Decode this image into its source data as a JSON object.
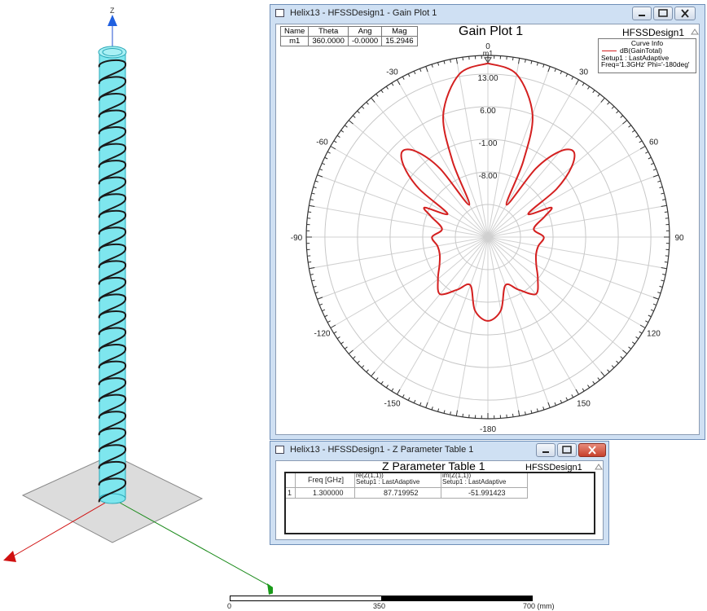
{
  "model_view": {
    "axis_z_label": "Z"
  },
  "scale_bar": {
    "labels": [
      "0",
      "350",
      "700 (mm)"
    ]
  },
  "gain_window": {
    "title": "Helix13 - HFSSDesign1 - Gain Plot 1",
    "plot_title": "Gain Plot 1",
    "design_name": "HFSSDesign1",
    "marker_table": {
      "headers": [
        "Name",
        "Theta",
        "Ang",
        "Mag"
      ],
      "row": [
        "m1",
        "360.0000",
        "-0.0000",
        "15.2946"
      ]
    },
    "curve_info": {
      "title": "Curve Info",
      "trace": "dB(GainTotal)",
      "setup": "Setup1 : LastAdaptive",
      "freq": "Freq='1.3GHz' Phi='-180deg'"
    },
    "marker_label": "m1",
    "accent_color": "#d42020"
  },
  "chart_data": {
    "type": "polar",
    "title": "Gain Plot 1",
    "series": [
      {
        "name": "dB(GainTotal)",
        "theta_deg": [
          0,
          10,
          20,
          25,
          30,
          35,
          40,
          45,
          50,
          55,
          60,
          65,
          70,
          80,
          90,
          100,
          110,
          120,
          130,
          140,
          150,
          160,
          170,
          180,
          190,
          200,
          210,
          220,
          230,
          240,
          250,
          260,
          270,
          280,
          290,
          295,
          300,
          305,
          310,
          315,
          320,
          325,
          330,
          335,
          340,
          350,
          360
        ],
        "values": [
          15.3,
          13.5,
          6.0,
          -4.0,
          -14.0,
          -4.0,
          2.0,
          4.0,
          1.5,
          -4.0,
          -12.0,
          -7.0,
          -9.0,
          -12.0,
          -10.0,
          -11.0,
          -11.0,
          -10.0,
          -8.0,
          -6.0,
          -9.0,
          -11.0,
          -6.0,
          -4.0,
          -6.0,
          -11.0,
          -9.0,
          -6.0,
          -8.0,
          -10.0,
          -11.0,
          -11.0,
          -10.0,
          -12.0,
          -9.0,
          -7.0,
          -12.0,
          -4.0,
          1.5,
          4.0,
          2.0,
          -4.0,
          -14.0,
          -4.0,
          6.0,
          13.5,
          15.3
        ]
      }
    ],
    "radial_ticks": [
      "13.00",
      "6.00",
      "-1.00",
      "-8.00"
    ],
    "rlim": [
      -22,
      17
    ],
    "angle_labels": [
      "0",
      "30",
      "60",
      "90",
      "120",
      "150",
      "-180",
      "-150",
      "-120",
      "-90",
      "-60",
      "-30"
    ],
    "grid": true,
    "legend": "top-right"
  },
  "zparam_window": {
    "title": "Helix13 - HFSSDesign1 - Z Parameter Table 1",
    "table_title": "Z Parameter Table 1",
    "design_name": "HFSSDesign1",
    "col_freq": "Freq [GHz]",
    "col_re_top": "re(Z(1,1))",
    "col_re_bottom": "Setup1 : LastAdaptive",
    "col_im_top": "im(Z(1,1))",
    "col_im_bottom": "Setup1 : LastAdaptive",
    "row_index": "1",
    "freq": "1.300000",
    "re": "87.719952",
    "im": "-51.991423"
  }
}
